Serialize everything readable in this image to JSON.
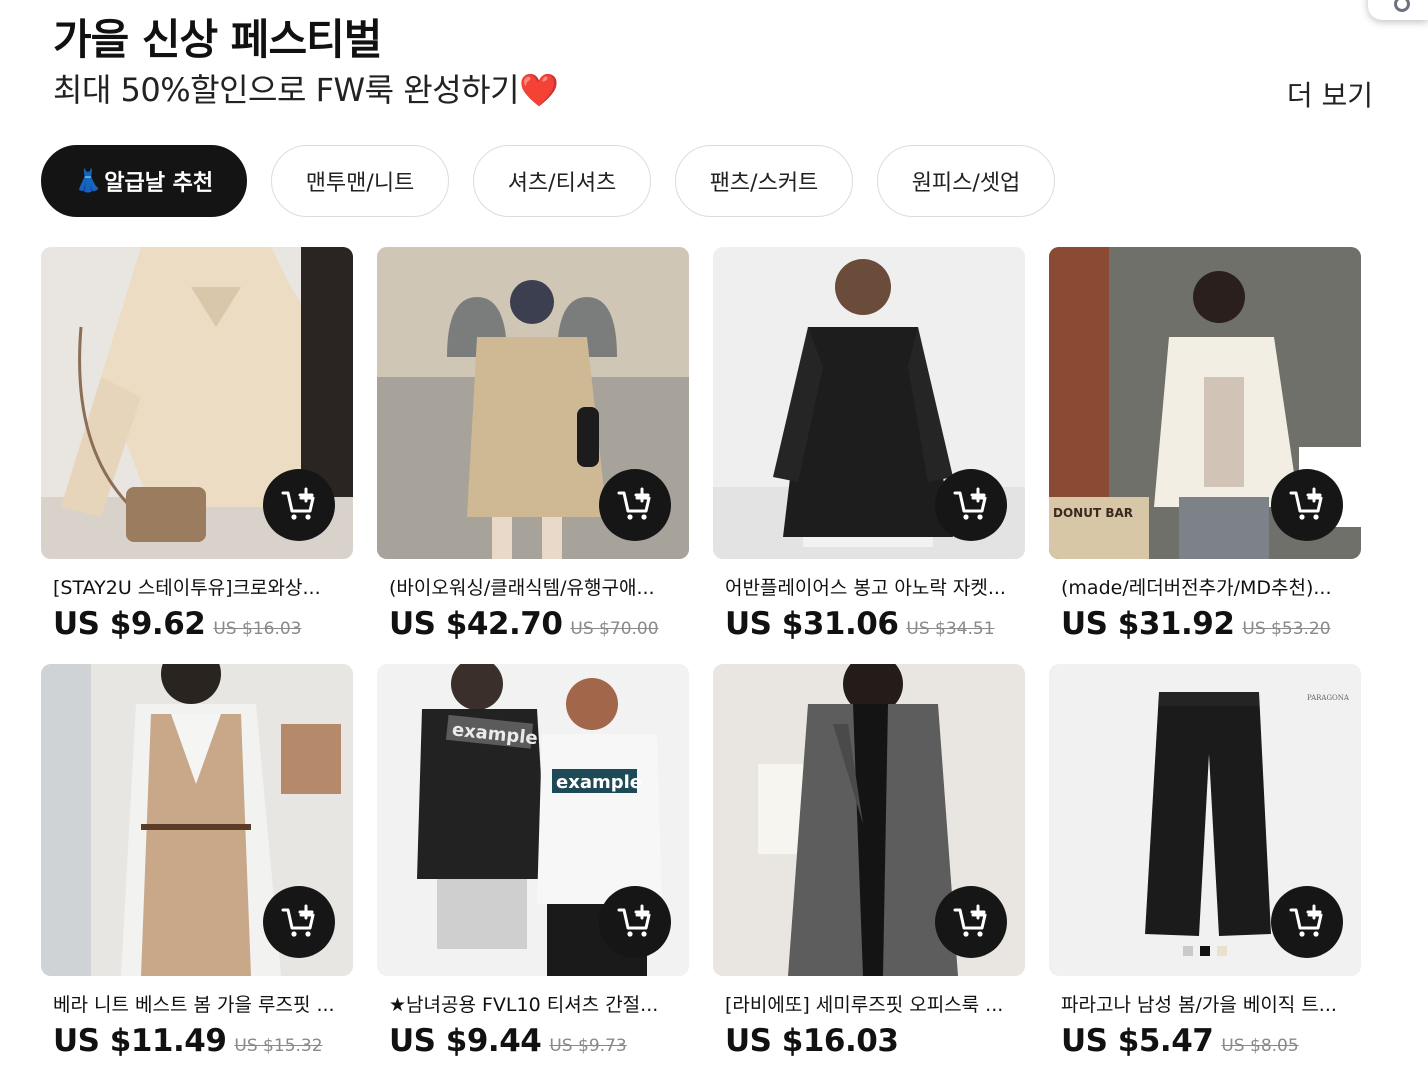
{
  "header": {
    "title": "가을 신상 페스티벌",
    "subtitle": "최대 50%할인으로 FW룩 완성하기",
    "subtitle_emoji": "❤️",
    "more_label": "더 보기"
  },
  "tabs": [
    {
      "emoji": "👗",
      "label": "알급날 추천",
      "active": true
    },
    {
      "label": "맨투맨/니트"
    },
    {
      "label": "셔츠/티셔츠"
    },
    {
      "label": "팬츠/스커트"
    },
    {
      "label": "원피스/셋업"
    }
  ],
  "products": [
    {
      "name": "[STAY2U 스테이투유]크로와상...",
      "price": "US $9.62",
      "original_price": "US $16.03"
    },
    {
      "name": "(바이오워싱/클래식템/유행구애...",
      "price": "US $42.70",
      "original_price": "US $70.00"
    },
    {
      "name": "어반플레이어스 봉고 아노락 자켓...",
      "price": "US $31.06",
      "original_price": "US $34.51"
    },
    {
      "name": "(made/레더버전추가/MD추천)...",
      "price": "US $31.92",
      "original_price": "US $53.20"
    },
    {
      "name": "베라 니트 베스트 봄 가을 루즈핏 ...",
      "price": "US $11.49",
      "original_price": "US $15.32"
    },
    {
      "name": "★남녀공용 FVL10 티셔츠 간절...",
      "price": "US $9.44",
      "original_price": "US $9.73"
    },
    {
      "name": "[라비에또] 세미루즈핏 오피스룩 ...",
      "price": "US $16.03",
      "original_price": ""
    },
    {
      "name": "파라고나 남성 봄/가을 베이직 트...",
      "price": "US $5.47",
      "original_price": "US $8.05"
    }
  ],
  "icons": {
    "cart": "add-to-cart-icon",
    "heart": "heart-icon"
  },
  "image_text": {
    "shirt_print": "example",
    "shop_sign": "DONUT BAR",
    "brand_logo": "PARAGONA"
  },
  "colors": {
    "active_tab_bg": "#141414",
    "cart_button_bg": "#161616",
    "heart": "#e0202e"
  }
}
